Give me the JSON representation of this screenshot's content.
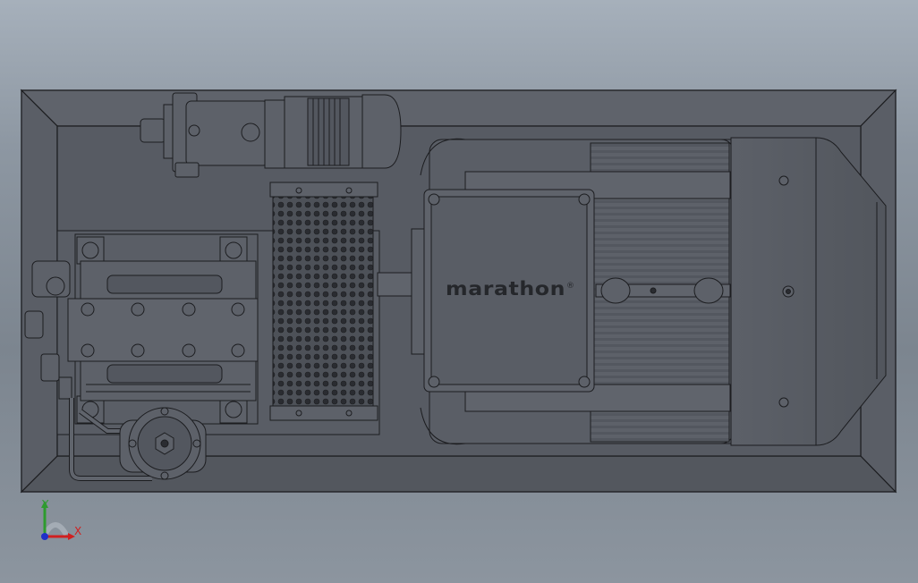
{
  "model": {
    "motor_brand": "marathon",
    "motor_brand_mark": "®"
  },
  "triad": {
    "y_label": "Y",
    "x_label": "X",
    "y_color": "#2e9b2e",
    "x_color": "#d02020",
    "z_color": "#2030c8"
  },
  "colors": {
    "background_top": "#a6b0bb",
    "background_bottom": "#7c858f",
    "metal_fill": "#5d6169",
    "metal_dark": "#45484f",
    "edge_line": "#1c1d20"
  }
}
